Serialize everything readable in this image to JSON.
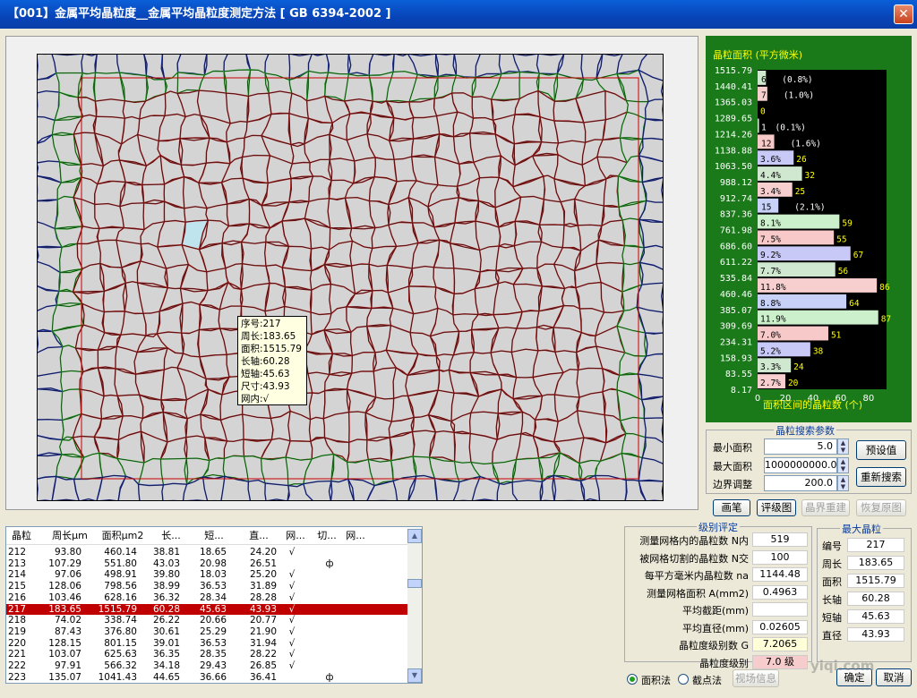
{
  "window": {
    "title": "【001】金属平均晶粒度__金属平均晶粒度测定方法 [ GB 6394-2002 ]",
    "close_icon": "close-icon"
  },
  "tooltip": {
    "lines": [
      "序号:217",
      "周长:183.65",
      "面积:1515.79",
      "长轴:60.28",
      "短轴:45.63",
      "尺寸:43.93",
      "网内:√"
    ]
  },
  "chart_data": {
    "type": "bar",
    "title": "晶粒面积 (平方微米)",
    "xlabel": "面积区间的晶粒数 (个)",
    "x_ticks": [
      "0",
      "20",
      "40",
      "60",
      "80"
    ],
    "xlim": [
      0,
      93
    ],
    "orientation": "horizontal",
    "categories": [
      "1515.79",
      "1440.41",
      "1365.03",
      "1289.65",
      "1214.26",
      "1138.88",
      "1063.50",
      "988.12",
      "912.74",
      "837.36",
      "761.98",
      "686.60",
      "611.22",
      "535.84",
      "460.46",
      "385.07",
      "309.69",
      "234.31",
      "158.93",
      "83.55",
      "8.17"
    ],
    "values": [
      6,
      7,
      0,
      1,
      12,
      26,
      32,
      25,
      15,
      59,
      55,
      67,
      56,
      86,
      64,
      87,
      51,
      38,
      24,
      20
    ],
    "percent_labels": [
      "(0.8%)",
      "(1.0%)",
      "",
      "(0.1%)",
      "(1.6%)",
      "3.6%",
      "4.4%",
      "3.4%",
      "(2.1%)",
      "8.1%",
      "7.5%",
      "9.2%",
      "7.7%",
      "11.8%",
      "8.8%",
      "11.9%",
      "7.0%",
      "5.2%",
      "3.3%",
      "2.7%"
    ],
    "bar_colors": [
      "#cfe8cf",
      "#f7cfcf",
      "#c8d2f8",
      "#ccf0cc",
      "#f8c9c9",
      "#c9c9f8"
    ],
    "background": "#1a7a1a",
    "plot_bg": "#000000"
  },
  "search_params": {
    "legend": "晶粒搜索参数",
    "min_area_label": "最小面积",
    "min_area": "5.0",
    "max_area_label": "最大面积",
    "max_area": "1000000000.0",
    "border_label": "边界调整",
    "border": "200.0",
    "preset_button": "预设值",
    "research_button": "重新搜索"
  },
  "tools": {
    "brush": "画笔",
    "grade_image": "评级图",
    "rebuild": "晶界重建",
    "restore": "恢复原图"
  },
  "table": {
    "headers": [
      "晶粒",
      "周长μm",
      "面积μm2",
      "长...",
      "短...",
      "直...",
      "网...",
      "切...",
      "网..."
    ],
    "rows": [
      [
        "212",
        "93.80",
        "460.14",
        "38.81",
        "18.65",
        "24.20",
        "√",
        "",
        ""
      ],
      [
        "213",
        "107.29",
        "551.80",
        "43.03",
        "20.98",
        "26.51",
        "",
        "ф",
        ""
      ],
      [
        "214",
        "97.06",
        "498.91",
        "39.80",
        "18.03",
        "25.20",
        "√",
        "",
        ""
      ],
      [
        "215",
        "128.06",
        "798.56",
        "38.99",
        "36.53",
        "31.89",
        "√",
        "",
        ""
      ],
      [
        "216",
        "103.46",
        "628.16",
        "36.32",
        "28.34",
        "28.28",
        "√",
        "",
        ""
      ],
      [
        "217",
        "183.65",
        "1515.79",
        "60.28",
        "45.63",
        "43.93",
        "√",
        "",
        ""
      ],
      [
        "218",
        "74.02",
        "338.74",
        "26.22",
        "20.66",
        "20.77",
        "√",
        "",
        ""
      ],
      [
        "219",
        "87.43",
        "376.80",
        "30.61",
        "25.29",
        "21.90",
        "√",
        "",
        ""
      ],
      [
        "220",
        "128.15",
        "801.15",
        "39.01",
        "36.53",
        "31.94",
        "√",
        "",
        ""
      ],
      [
        "221",
        "103.07",
        "625.63",
        "36.35",
        "28.35",
        "28.22",
        "√",
        "",
        ""
      ],
      [
        "222",
        "97.91",
        "566.32",
        "34.18",
        "29.43",
        "26.85",
        "√",
        "",
        ""
      ],
      [
        "223",
        "135.07",
        "1041.43",
        "44.65",
        "36.66",
        "36.41",
        "",
        "ф",
        ""
      ]
    ],
    "selected_row": 5
  },
  "grading": {
    "legend": "级别评定",
    "items": [
      {
        "label": "测量网格内的晶粒数 N内",
        "value": "519"
      },
      {
        "label": "被网格切割的晶粒数 N交",
        "value": "100"
      },
      {
        "label": "每平方毫米内晶粒数 na",
        "value": "1144.48"
      },
      {
        "label": "测量网格面积 A(mm2)",
        "value": "0.4963"
      },
      {
        "label": "平均截距(mm)",
        "value": ""
      },
      {
        "label": "平均直径(mm)",
        "value": "0.02605"
      },
      {
        "label": "晶粒度级别数 G",
        "value": "7.2065"
      },
      {
        "label": "晶粒度级别",
        "value": "7.0 级"
      }
    ],
    "method_area": "面积法",
    "method_intercept": "截点法",
    "field_info": "视场信息"
  },
  "max_grain": {
    "legend": "最大晶粒",
    "items": [
      {
        "label": "编号",
        "value": "217"
      },
      {
        "label": "周长",
        "value": "183.65"
      },
      {
        "label": "面积",
        "value": "1515.79"
      },
      {
        "label": "长轴",
        "value": "60.28"
      },
      {
        "label": "短轴",
        "value": "45.63"
      },
      {
        "label": "直径",
        "value": "43.93"
      }
    ]
  },
  "footer": {
    "ok": "确定",
    "cancel": "取消"
  },
  "watermark": "yiqi.com 仪器网"
}
